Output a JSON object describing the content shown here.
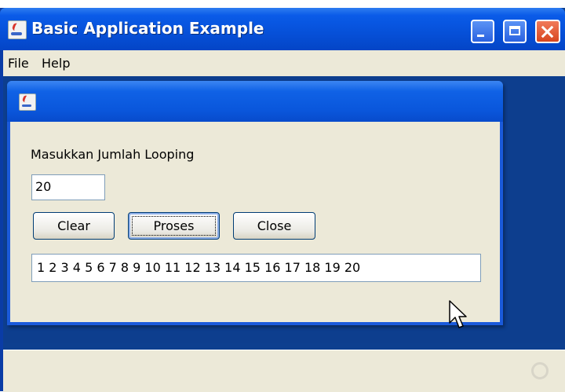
{
  "window": {
    "title": "Basic Application Example",
    "icon": "java-cup-icon",
    "controls": [
      "minimize-icon",
      "maximize-icon",
      "close-icon"
    ]
  },
  "menu": {
    "items": [
      "File",
      "Help"
    ]
  },
  "internal_frame": {
    "icon": "java-cup-icon",
    "prompt_label": "Masukkan Jumlah Looping",
    "input_value": "20",
    "buttons": {
      "clear": "Clear",
      "proses": "Proses",
      "close": "Close"
    },
    "output": "1 2 3 4 5 6 7 8 9 10 11 12 13 14 15 16 17 18 19 20"
  },
  "colors": {
    "title_bar": "#0650d8",
    "desktop": "#0d3e8e",
    "panel": "#ece9d8",
    "close_button": "#d8461f"
  }
}
